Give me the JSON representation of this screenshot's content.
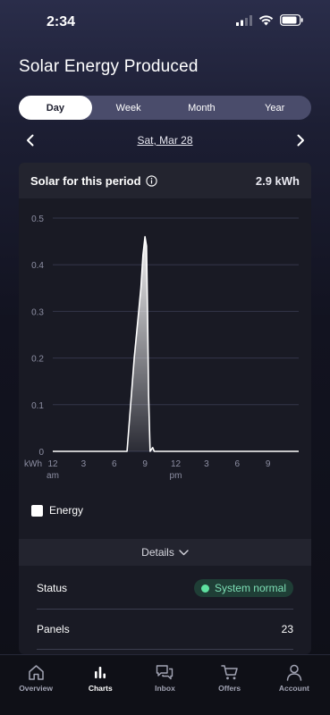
{
  "status_bar": {
    "time": "2:34"
  },
  "page": {
    "title": "Solar Energy Produced"
  },
  "tabs": [
    {
      "label": "Day",
      "active": true
    },
    {
      "label": "Week",
      "active": false
    },
    {
      "label": "Month",
      "active": false
    },
    {
      "label": "Year",
      "active": false
    }
  ],
  "date_nav": {
    "date": "Sat, Mar 28"
  },
  "card": {
    "title": "Solar for this period",
    "total": "2.9 kWh"
  },
  "chart_data": {
    "type": "area",
    "ylabel": "kWh",
    "ylim": [
      0,
      0.5
    ],
    "yticks": [
      "0",
      "0.1",
      "0.2",
      "0.3",
      "0.4",
      "0.5"
    ],
    "xticks": [
      {
        "label": "12",
        "sub": "am",
        "hour": 0
      },
      {
        "label": "3",
        "sub": "",
        "hour": 3
      },
      {
        "label": "6",
        "sub": "",
        "hour": 6
      },
      {
        "label": "9",
        "sub": "",
        "hour": 9
      },
      {
        "label": "12",
        "sub": "pm",
        "hour": 12
      },
      {
        "label": "3",
        "sub": "",
        "hour": 15
      },
      {
        "label": "6",
        "sub": "",
        "hour": 18
      },
      {
        "label": "9",
        "sub": "",
        "hour": 21
      }
    ],
    "xlim": [
      0,
      24
    ],
    "series": [
      {
        "name": "Energy",
        "color": "#ffffff",
        "points": [
          [
            0,
            0
          ],
          [
            7.25,
            0
          ],
          [
            7.6,
            0.1
          ],
          [
            7.95,
            0.2
          ],
          [
            8.3,
            0.28
          ],
          [
            8.6,
            0.35
          ],
          [
            8.8,
            0.42
          ],
          [
            9.0,
            0.46
          ],
          [
            9.15,
            0.44
          ],
          [
            9.25,
            0.3
          ],
          [
            9.35,
            0.12
          ],
          [
            9.5,
            0.0
          ],
          [
            9.75,
            0.008
          ],
          [
            9.9,
            0.0
          ],
          [
            24,
            0
          ]
        ]
      }
    ],
    "grid": true
  },
  "legend": {
    "label": "Energy"
  },
  "details": {
    "toggle_label": "Details",
    "rows": [
      {
        "label": "Status",
        "value": "System normal"
      },
      {
        "label": "Panels",
        "value": "23"
      }
    ]
  },
  "bottom_nav": [
    {
      "label": "Overview",
      "icon": "home-icon",
      "active": false
    },
    {
      "label": "Charts",
      "icon": "bar-chart-icon",
      "active": true
    },
    {
      "label": "Inbox",
      "icon": "chat-bubbles-icon",
      "active": false
    },
    {
      "label": "Offers",
      "icon": "cart-icon",
      "active": false
    },
    {
      "label": "Account",
      "icon": "person-icon",
      "active": false
    }
  ],
  "colors": {
    "accent": "#ffffff",
    "status_green": "#5ee0a0",
    "card_bg": "#191a24",
    "tab_bg": "#4a4c6b"
  }
}
